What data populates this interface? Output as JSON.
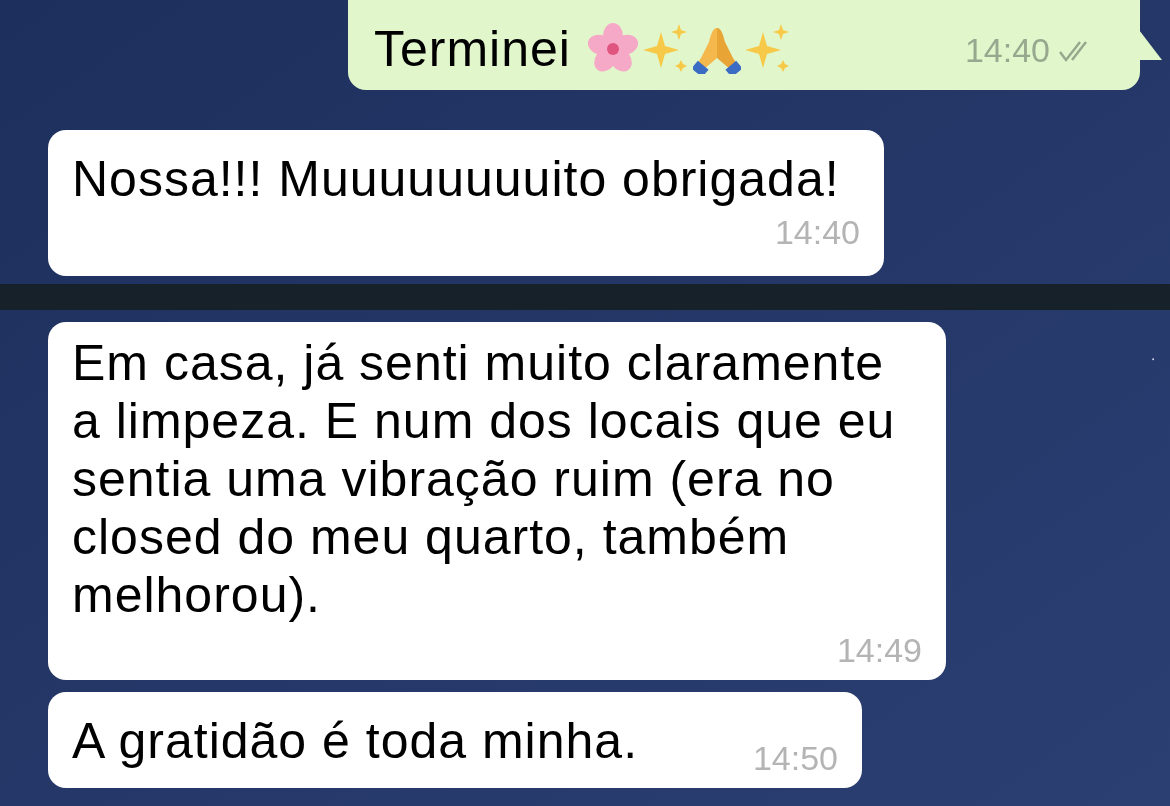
{
  "messages": [
    {
      "kind": "outgoing",
      "text": "Terminei",
      "time": "14:40",
      "read": true
    },
    {
      "kind": "incoming",
      "text": "Nossa!!! Muuuuuuuuito obrigada!",
      "time": "14:40"
    },
    {
      "kind": "divider"
    },
    {
      "kind": "incoming",
      "text": "Em casa, já senti muito claramente a limpeza. E num dos locais que eu sentia uma vibração ruim (era no closed do meu quarto, também melhorou).",
      "time": "14:49"
    },
    {
      "kind": "incoming",
      "text": "A gratidão é toda minha.",
      "time": "14:50"
    }
  ]
}
